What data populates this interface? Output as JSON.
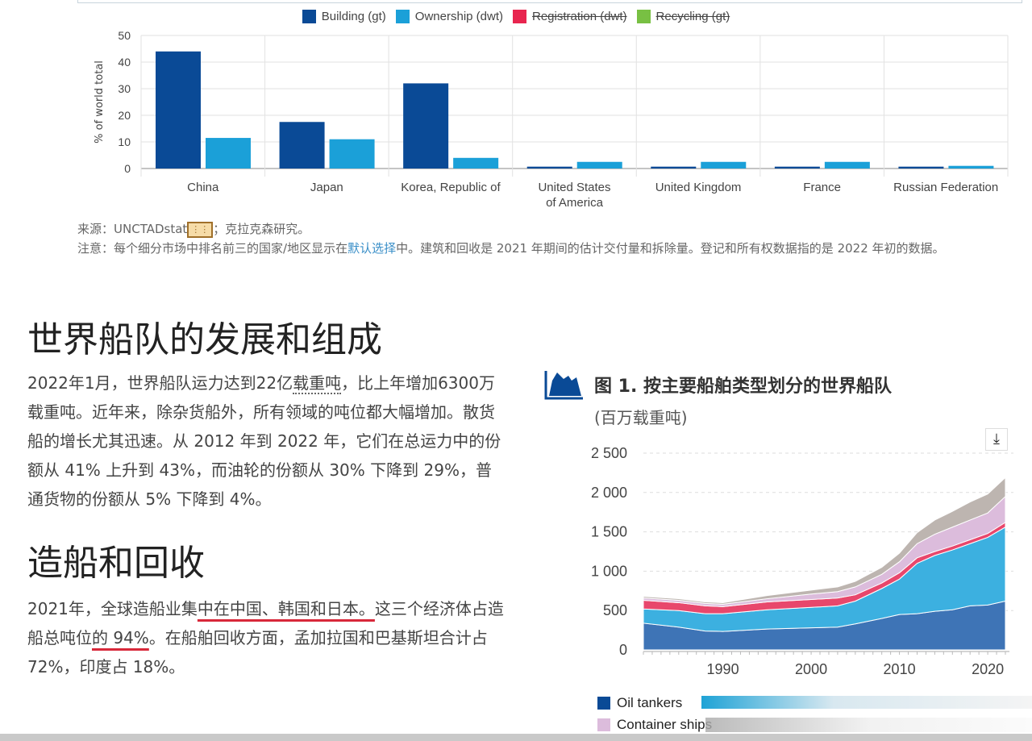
{
  "bar_chart": {
    "chart_data": {
      "type": "bar",
      "categories": [
        "China",
        "Japan",
        "Korea, Republic of",
        "United States|of America",
        "United Kingdom",
        "France",
        "Russian Federation"
      ],
      "series": [
        {
          "name": "Building (gt)",
          "color": "#0a4a96",
          "values": [
            44,
            17.5,
            32,
            0.7,
            0.7,
            0.7,
            0.7
          ],
          "visible": true
        },
        {
          "name": "Ownership (dwt)",
          "color": "#1ba0d8",
          "values": [
            11.5,
            11,
            4,
            2.5,
            2.5,
            2.5,
            1
          ],
          "visible": true
        },
        {
          "name": "Registration (dwt)",
          "color": "#e8254f",
          "visible": false
        },
        {
          "name": "Recycling (gt)",
          "color": "#78c043",
          "visible": false
        }
      ],
      "ylabel": "% of world total",
      "ylim": [
        0,
        50
      ],
      "yticks": [
        0,
        10,
        20,
        30,
        40,
        50
      ],
      "grid": true,
      "legend": "top"
    }
  },
  "source": {
    "source_label": "来源：",
    "source_text": "UNCTADstat",
    "source_rest": "；克拉克森研究。",
    "note_label": "注意：",
    "note_pre": "每个细分市场中排名前三的国家/地区显示在",
    "note_link": "默认选择",
    "note_post": "中。建筑和回收是 2021 年期间的估计交付量和拆除量。登记和所有权数据指的是 2022 年初的数据。"
  },
  "section1": {
    "heading": "世界船队的发展和组成",
    "p_pre": "2022年1月，世界船队运力达到22亿",
    "p_dotted": "载重吨",
    "p_post": "，比上年增加6300万载重吨。近年来，除杂货船外，所有领域的吨位都大幅增加。散货船的增长尤其迅速。从 2012 年到 2022 年，它们在总运力中的份额从 41% 上升到 43%，而油轮的份额从 30% 下降到 29%，普通货物的份额从 5% 下降到 4%。"
  },
  "section2": {
    "heading": "造船和回收",
    "p1": "2021年，全球造船业集",
    "u1": "中在中国、韩国和日本。",
    "p2": "这三个经济体占造船总吨位",
    "u2": "的 94%",
    "p3": "。在船舶回收方面，孟加拉国和巴基斯坦合计占 72%，印度占 18%。"
  },
  "figure": {
    "icon": "area-chart-icon",
    "title": "图 1. 按主要船舶类型划分的世界船队",
    "subtitle": "(百万载重吨)",
    "download_icon": "download-icon",
    "legend": [
      {
        "name": "Oil tankers",
        "color": "#0a4a96"
      },
      {
        "name": "Container ships",
        "color": "#dcbcdc"
      }
    ],
    "chart_data": {
      "type": "area",
      "stacked": true,
      "x": [
        1981,
        1985,
        1988,
        1990,
        1995,
        2000,
        2003,
        2005,
        2008,
        2010,
        2012,
        2014,
        2016,
        2018,
        2020,
        2022
      ],
      "series": [
        {
          "name": "Oil tankers",
          "color": "#3e74b6",
          "values": [
            340,
            290,
            240,
            235,
            265,
            280,
            290,
            330,
            400,
            450,
            460,
            490,
            510,
            560,
            570,
            620
          ]
        },
        {
          "color": "#3cb0e0",
          "values": [
            180,
            210,
            220,
            225,
            245,
            260,
            270,
            290,
            380,
            450,
            640,
            710,
            760,
            790,
            860,
            940
          ]
        },
        {
          "color": "#e8476c",
          "values": [
            110,
            100,
            100,
            90,
            100,
            100,
            100,
            80,
            70,
            80,
            70,
            50,
            50,
            50,
            50,
            60
          ]
        },
        {
          "name": "Container ships",
          "color": "#dcbcdc",
          "values": [
            30,
            30,
            30,
            30,
            40,
            70,
            80,
            100,
            110,
            140,
            180,
            220,
            240,
            250,
            260,
            330
          ]
        },
        {
          "color": "#bdb5b0",
          "values": [
            20,
            20,
            20,
            20,
            40,
            50,
            60,
            70,
            90,
            110,
            140,
            180,
            200,
            230,
            240,
            240
          ]
        }
      ],
      "ylim": [
        0,
        2500
      ],
      "yticks": [
        "0",
        "500",
        "1 000",
        "1 500",
        "2 000",
        "2 500"
      ],
      "xticks": [
        1990,
        2000,
        2010,
        2020
      ],
      "grid": true
    }
  }
}
